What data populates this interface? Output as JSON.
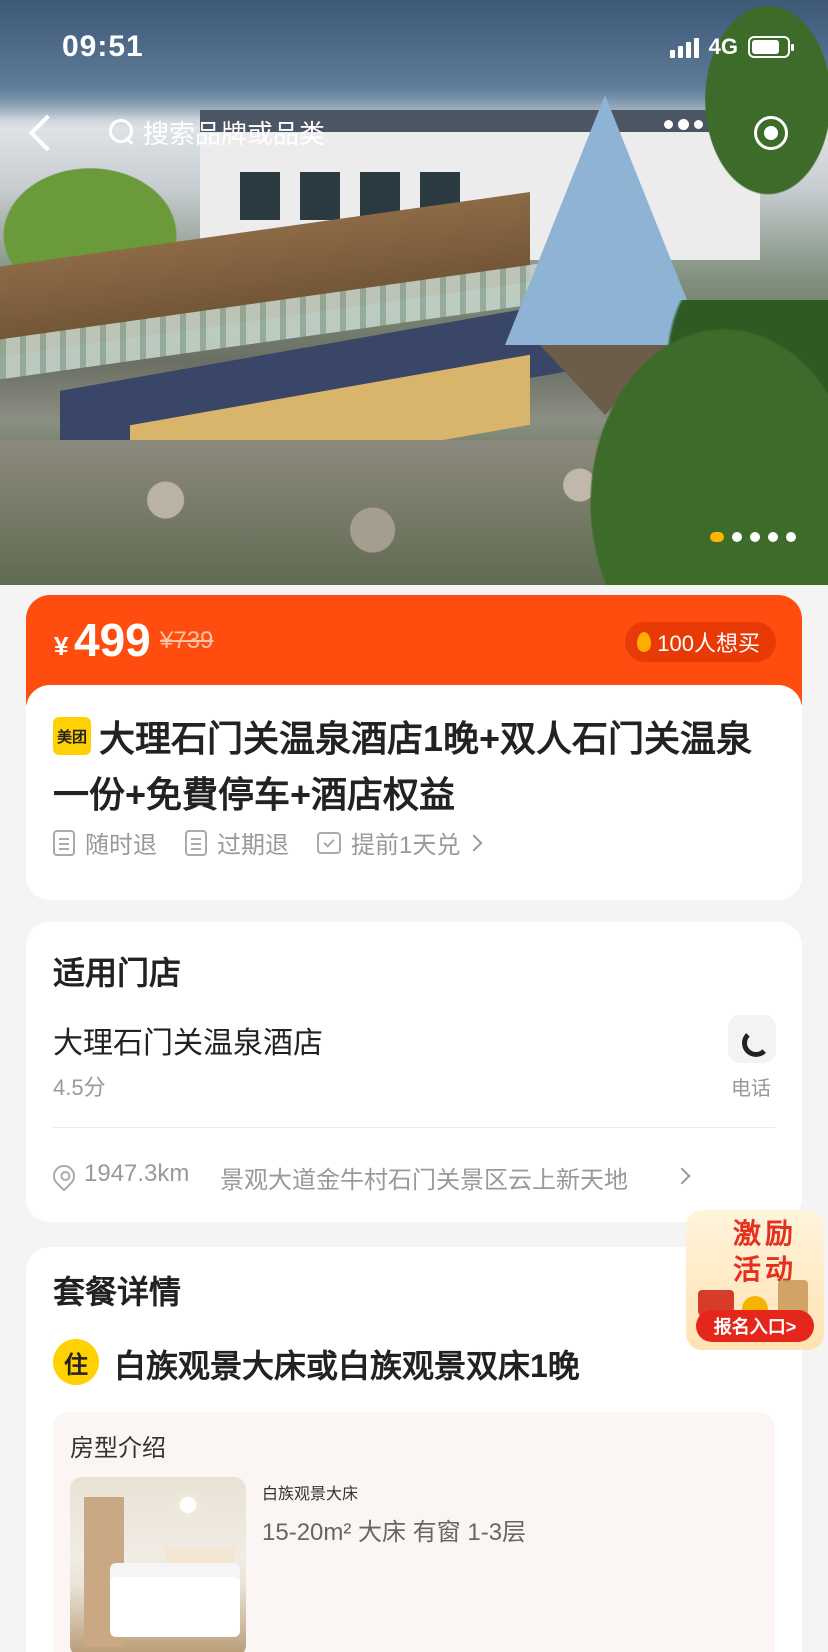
{
  "status_bar": {
    "time": "09:51",
    "network": "4G",
    "battery_level": 0.8
  },
  "nav": {
    "search_placeholder": "搜索品牌或品类"
  },
  "hero": {
    "carousel_count": 5,
    "active_index": 0
  },
  "price": {
    "currency": "¥",
    "current": "499",
    "original": "¥739",
    "want_count": "100人想买"
  },
  "deal": {
    "brand_badge": "美团",
    "title": "大理石门关温泉酒店1晚+双人石门关温泉一份+免費停车+酒店权益",
    "tags": [
      "随时退",
      "过期退",
      "提前1天兑"
    ]
  },
  "store": {
    "section_title": "适用门店",
    "name": "大理石门关温泉酒店",
    "score": "4.5分",
    "phone_label": "电话",
    "distance": "1947.3km",
    "address": "景观大道金牛村石门关景区云上新天地"
  },
  "package": {
    "section_title": "套餐详情",
    "stay_badge": "住",
    "name": "白族观景大床或白族观景双床1晚",
    "room_section": "房型介绍",
    "room_type": "白族观景大床",
    "room_spec": "15-20m²  大床  有窗  1-3层"
  },
  "promo": {
    "title": "激励活动",
    "button": "报名入口>"
  },
  "colors": {
    "accent": "#ff4d0f",
    "brand_yellow": "#ffd100",
    "promo_red": "#e5271b"
  }
}
